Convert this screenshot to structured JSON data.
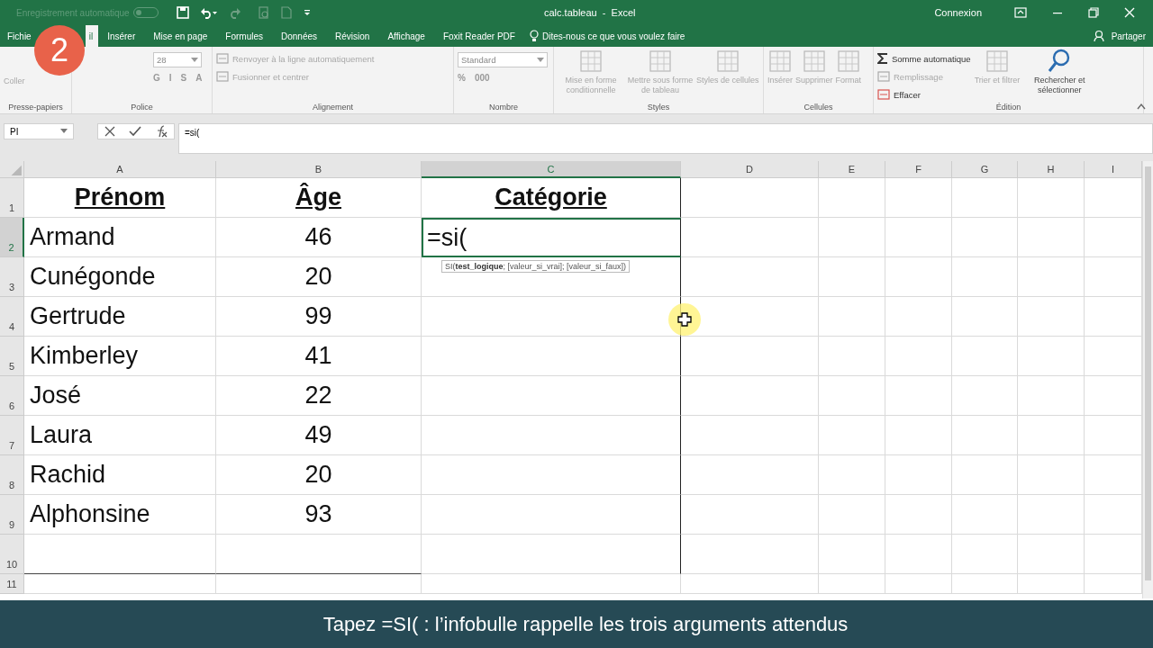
{
  "title_bar": {
    "autosave_label": "Enregistrement automatique",
    "autosave_on": false,
    "title": "calc.tableau  -  Excel",
    "signin": "Connexion"
  },
  "tabs": [
    {
      "label": "Fichie",
      "selected": false
    },
    {
      "label": "il",
      "selected": true
    },
    {
      "label": "Insérer",
      "selected": false
    },
    {
      "label": "Mise en page",
      "selected": false
    },
    {
      "label": "Formules",
      "selected": false
    },
    {
      "label": "Données",
      "selected": false
    },
    {
      "label": "Révision",
      "selected": false
    },
    {
      "label": "Affichage",
      "selected": false
    },
    {
      "label": "Foxit Reader PDF",
      "selected": false
    }
  ],
  "tell_me": "Dites-nous ce que vous voulez faire",
  "share": "Partager",
  "ribbon": [
    {
      "name": "Presse-papiers",
      "items": [
        {
          "kind": "large",
          "label": "Coller",
          "disabled": true
        }
      ]
    },
    {
      "name": "Police",
      "items": [
        {
          "kind": "field",
          "label": "28"
        },
        {
          "kind": "glyph",
          "label": "G"
        },
        {
          "kind": "glyph",
          "label": "I"
        },
        {
          "kind": "glyph",
          "label": "S"
        },
        {
          "kind": "glyph",
          "label": "A"
        }
      ]
    },
    {
      "name": "Alignement",
      "items": [
        {
          "kind": "small",
          "label": "Renvoyer à la ligne automatiquement",
          "disabled": true
        },
        {
          "kind": "small",
          "label": "Fusionner et centrer",
          "disabled": true
        }
      ]
    },
    {
      "name": "Nombre",
      "items": [
        {
          "kind": "field",
          "label": "Standard"
        },
        {
          "kind": "glyph",
          "label": "%"
        },
        {
          "kind": "glyph",
          "label": "000"
        }
      ]
    },
    {
      "name": "Styles",
      "items": [
        {
          "kind": "large",
          "label": "Mise en forme conditionnelle",
          "disabled": true
        },
        {
          "kind": "large",
          "label": "Mettre sous forme de tableau",
          "disabled": true
        },
        {
          "kind": "large",
          "label": "Styles de cellules",
          "disabled": true
        }
      ]
    },
    {
      "name": "Cellules",
      "items": [
        {
          "kind": "large",
          "label": "Insérer",
          "disabled": true
        },
        {
          "kind": "large",
          "label": "Supprimer",
          "disabled": true
        },
        {
          "kind": "large",
          "label": "Format",
          "disabled": true
        }
      ]
    },
    {
      "name": "Édition",
      "items": [
        {
          "kind": "small",
          "label": "Somme automatique",
          "disabled": false
        },
        {
          "kind": "small",
          "label": "Remplissage",
          "disabled": true
        },
        {
          "kind": "small",
          "label": "Effacer",
          "disabled": false
        },
        {
          "kind": "large",
          "label": "Trier et filtrer",
          "disabled": true
        },
        {
          "kind": "large",
          "label": "Rechercher et sélectionner",
          "disabled": false
        }
      ]
    }
  ],
  "formula_bar": {
    "name_box": "PI",
    "formula": "=si("
  },
  "sheet": {
    "columns": [
      {
        "label": "A",
        "selected": false
      },
      {
        "label": "B",
        "selected": false
      },
      {
        "label": "C",
        "selected": true
      },
      {
        "label": "D",
        "selected": false
      },
      {
        "label": "E",
        "selected": false
      },
      {
        "label": "F",
        "selected": false
      },
      {
        "label": "G",
        "selected": false
      },
      {
        "label": "H",
        "selected": false
      },
      {
        "label": "I",
        "selected": false
      }
    ],
    "rows": [
      {
        "label": "1",
        "selected": false,
        "cells": [
          {
            "kind": "header",
            "text": "Prénom"
          },
          {
            "kind": "header",
            "text": "Âge"
          },
          {
            "kind": "header",
            "text": "Catégorie"
          }
        ]
      },
      {
        "label": "2",
        "selected": true,
        "cells": [
          {
            "kind": "text",
            "text": "Armand"
          },
          {
            "kind": "number",
            "text": "46"
          },
          {
            "kind": "editing",
            "text": "=si("
          }
        ]
      },
      {
        "label": "3",
        "selected": false,
        "cells": [
          {
            "kind": "text",
            "text": "Cunégonde"
          },
          {
            "kind": "number",
            "text": "20"
          }
        ]
      },
      {
        "label": "4",
        "selected": false,
        "cells": [
          {
            "kind": "text",
            "text": "Gertrude"
          },
          {
            "kind": "number",
            "text": "99"
          }
        ]
      },
      {
        "label": "5",
        "selected": false,
        "cells": [
          {
            "kind": "text",
            "text": "Kimberley"
          },
          {
            "kind": "number",
            "text": "41"
          }
        ]
      },
      {
        "label": "6",
        "selected": false,
        "cells": [
          {
            "kind": "text",
            "text": "José"
          },
          {
            "kind": "number",
            "text": "22"
          }
        ]
      },
      {
        "label": "7",
        "selected": false,
        "cells": [
          {
            "kind": "text",
            "text": "Laura"
          },
          {
            "kind": "number",
            "text": "49"
          }
        ]
      },
      {
        "label": "8",
        "selected": false,
        "cells": [
          {
            "kind": "text",
            "text": "Rachid"
          },
          {
            "kind": "number",
            "text": "20"
          }
        ]
      },
      {
        "label": "9",
        "selected": false,
        "cells": [
          {
            "kind": "text",
            "text": "Alphonsine"
          },
          {
            "kind": "number",
            "text": "93"
          }
        ]
      },
      {
        "label": "10",
        "selected": false,
        "cells": []
      },
      {
        "label": "11",
        "selected": false,
        "cells": []
      }
    ],
    "tooltip": "SI(**test_logique**; [valeur_si_vrai]; [valeur_si_faux])"
  },
  "step_badge": "2",
  "caption": "Tapez =SI( : l’infobulle rappelle les trois arguments attendus"
}
